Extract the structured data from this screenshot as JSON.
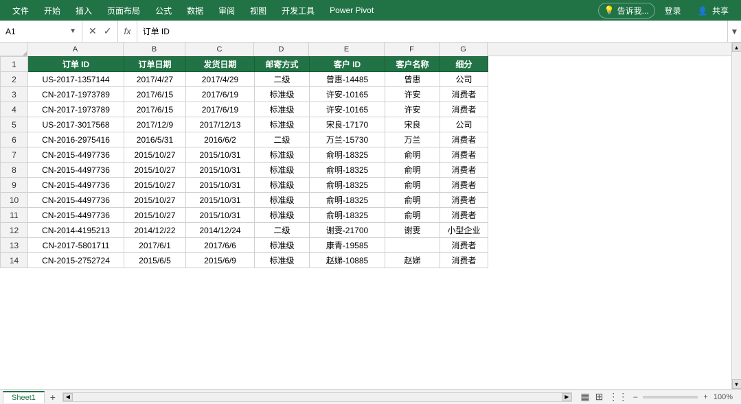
{
  "menubar": {
    "items": [
      "文件",
      "开始",
      "插入",
      "页面布局",
      "公式",
      "数据",
      "审阅",
      "视图",
      "开发工具",
      "Power Pivot"
    ],
    "tell_me": "告诉我...",
    "login": "登录",
    "share": "共享"
  },
  "formula_bar": {
    "cell_ref": "A1",
    "cancel_icon": "✕",
    "confirm_icon": "✓",
    "fx_label": "fx",
    "content": "订单 ID"
  },
  "columns": {
    "letters": [
      "A",
      "B",
      "C",
      "D",
      "E",
      "F",
      "G"
    ],
    "headers": [
      "订单 ID",
      "订单日期",
      "发货日期",
      "邮寄方式",
      "客户 ID",
      "客户名称",
      "细分"
    ]
  },
  "rows": [
    {
      "num": 2,
      "a": "US-2017-1357144",
      "b": "2017/4/27",
      "c": "2017/4/29",
      "d": "二级",
      "e": "曾惠-14485",
      "f": "曾惠",
      "g": "公司"
    },
    {
      "num": 3,
      "a": "CN-2017-1973789",
      "b": "2017/6/15",
      "c": "2017/6/19",
      "d": "标准级",
      "e": "许安-10165",
      "f": "许安",
      "g": "消费者"
    },
    {
      "num": 4,
      "a": "CN-2017-1973789",
      "b": "2017/6/15",
      "c": "2017/6/19",
      "d": "标准级",
      "e": "许安-10165",
      "f": "许安",
      "g": "消费者"
    },
    {
      "num": 5,
      "a": "US-2017-3017568",
      "b": "2017/12/9",
      "c": "2017/12/13",
      "d": "标准级",
      "e": "宋良-17170",
      "f": "宋良",
      "g": "公司"
    },
    {
      "num": 6,
      "a": "CN-2016-2975416",
      "b": "2016/5/31",
      "c": "2016/6/2",
      "d": "二级",
      "e": "万兰-15730",
      "f": "万兰",
      "g": "消费者"
    },
    {
      "num": 7,
      "a": "CN-2015-4497736",
      "b": "2015/10/27",
      "c": "2015/10/31",
      "d": "标准级",
      "e": "俞明-18325",
      "f": "俞明",
      "g": "消费者"
    },
    {
      "num": 8,
      "a": "CN-2015-4497736",
      "b": "2015/10/27",
      "c": "2015/10/31",
      "d": "标准级",
      "e": "俞明-18325",
      "f": "俞明",
      "g": "消费者"
    },
    {
      "num": 9,
      "a": "CN-2015-4497736",
      "b": "2015/10/27",
      "c": "2015/10/31",
      "d": "标准级",
      "e": "俞明-18325",
      "f": "俞明",
      "g": "消费者"
    },
    {
      "num": 10,
      "a": "CN-2015-4497736",
      "b": "2015/10/27",
      "c": "2015/10/31",
      "d": "标准级",
      "e": "俞明-18325",
      "f": "俞明",
      "g": "消费者"
    },
    {
      "num": 11,
      "a": "CN-2015-4497736",
      "b": "2015/10/27",
      "c": "2015/10/31",
      "d": "标准级",
      "e": "俞明-18325",
      "f": "俞明",
      "g": "消费者"
    },
    {
      "num": 12,
      "a": "CN-2014-4195213",
      "b": "2014/12/22",
      "c": "2014/12/24",
      "d": "二级",
      "e": "谢雯-21700",
      "f": "谢雯",
      "g": "小型企业"
    },
    {
      "num": 13,
      "a": "CN-2017-5801711",
      "b": "2017/6/1",
      "c": "2017/6/6",
      "d": "标准级",
      "e": "康青-19585",
      "f": "",
      "g": "消费者"
    },
    {
      "num": 14,
      "a": "CN-2015-2752724",
      "b": "2015/6/5",
      "c": "2015/6/9",
      "d": "标准级",
      "e": "赵娣-10885",
      "f": "赵娣",
      "g": "消费者"
    }
  ],
  "sheet_tab": "Sheet1",
  "colors": {
    "excel_green": "#217346",
    "header_bg": "#f2f2f2",
    "border": "#d0d0d0"
  }
}
